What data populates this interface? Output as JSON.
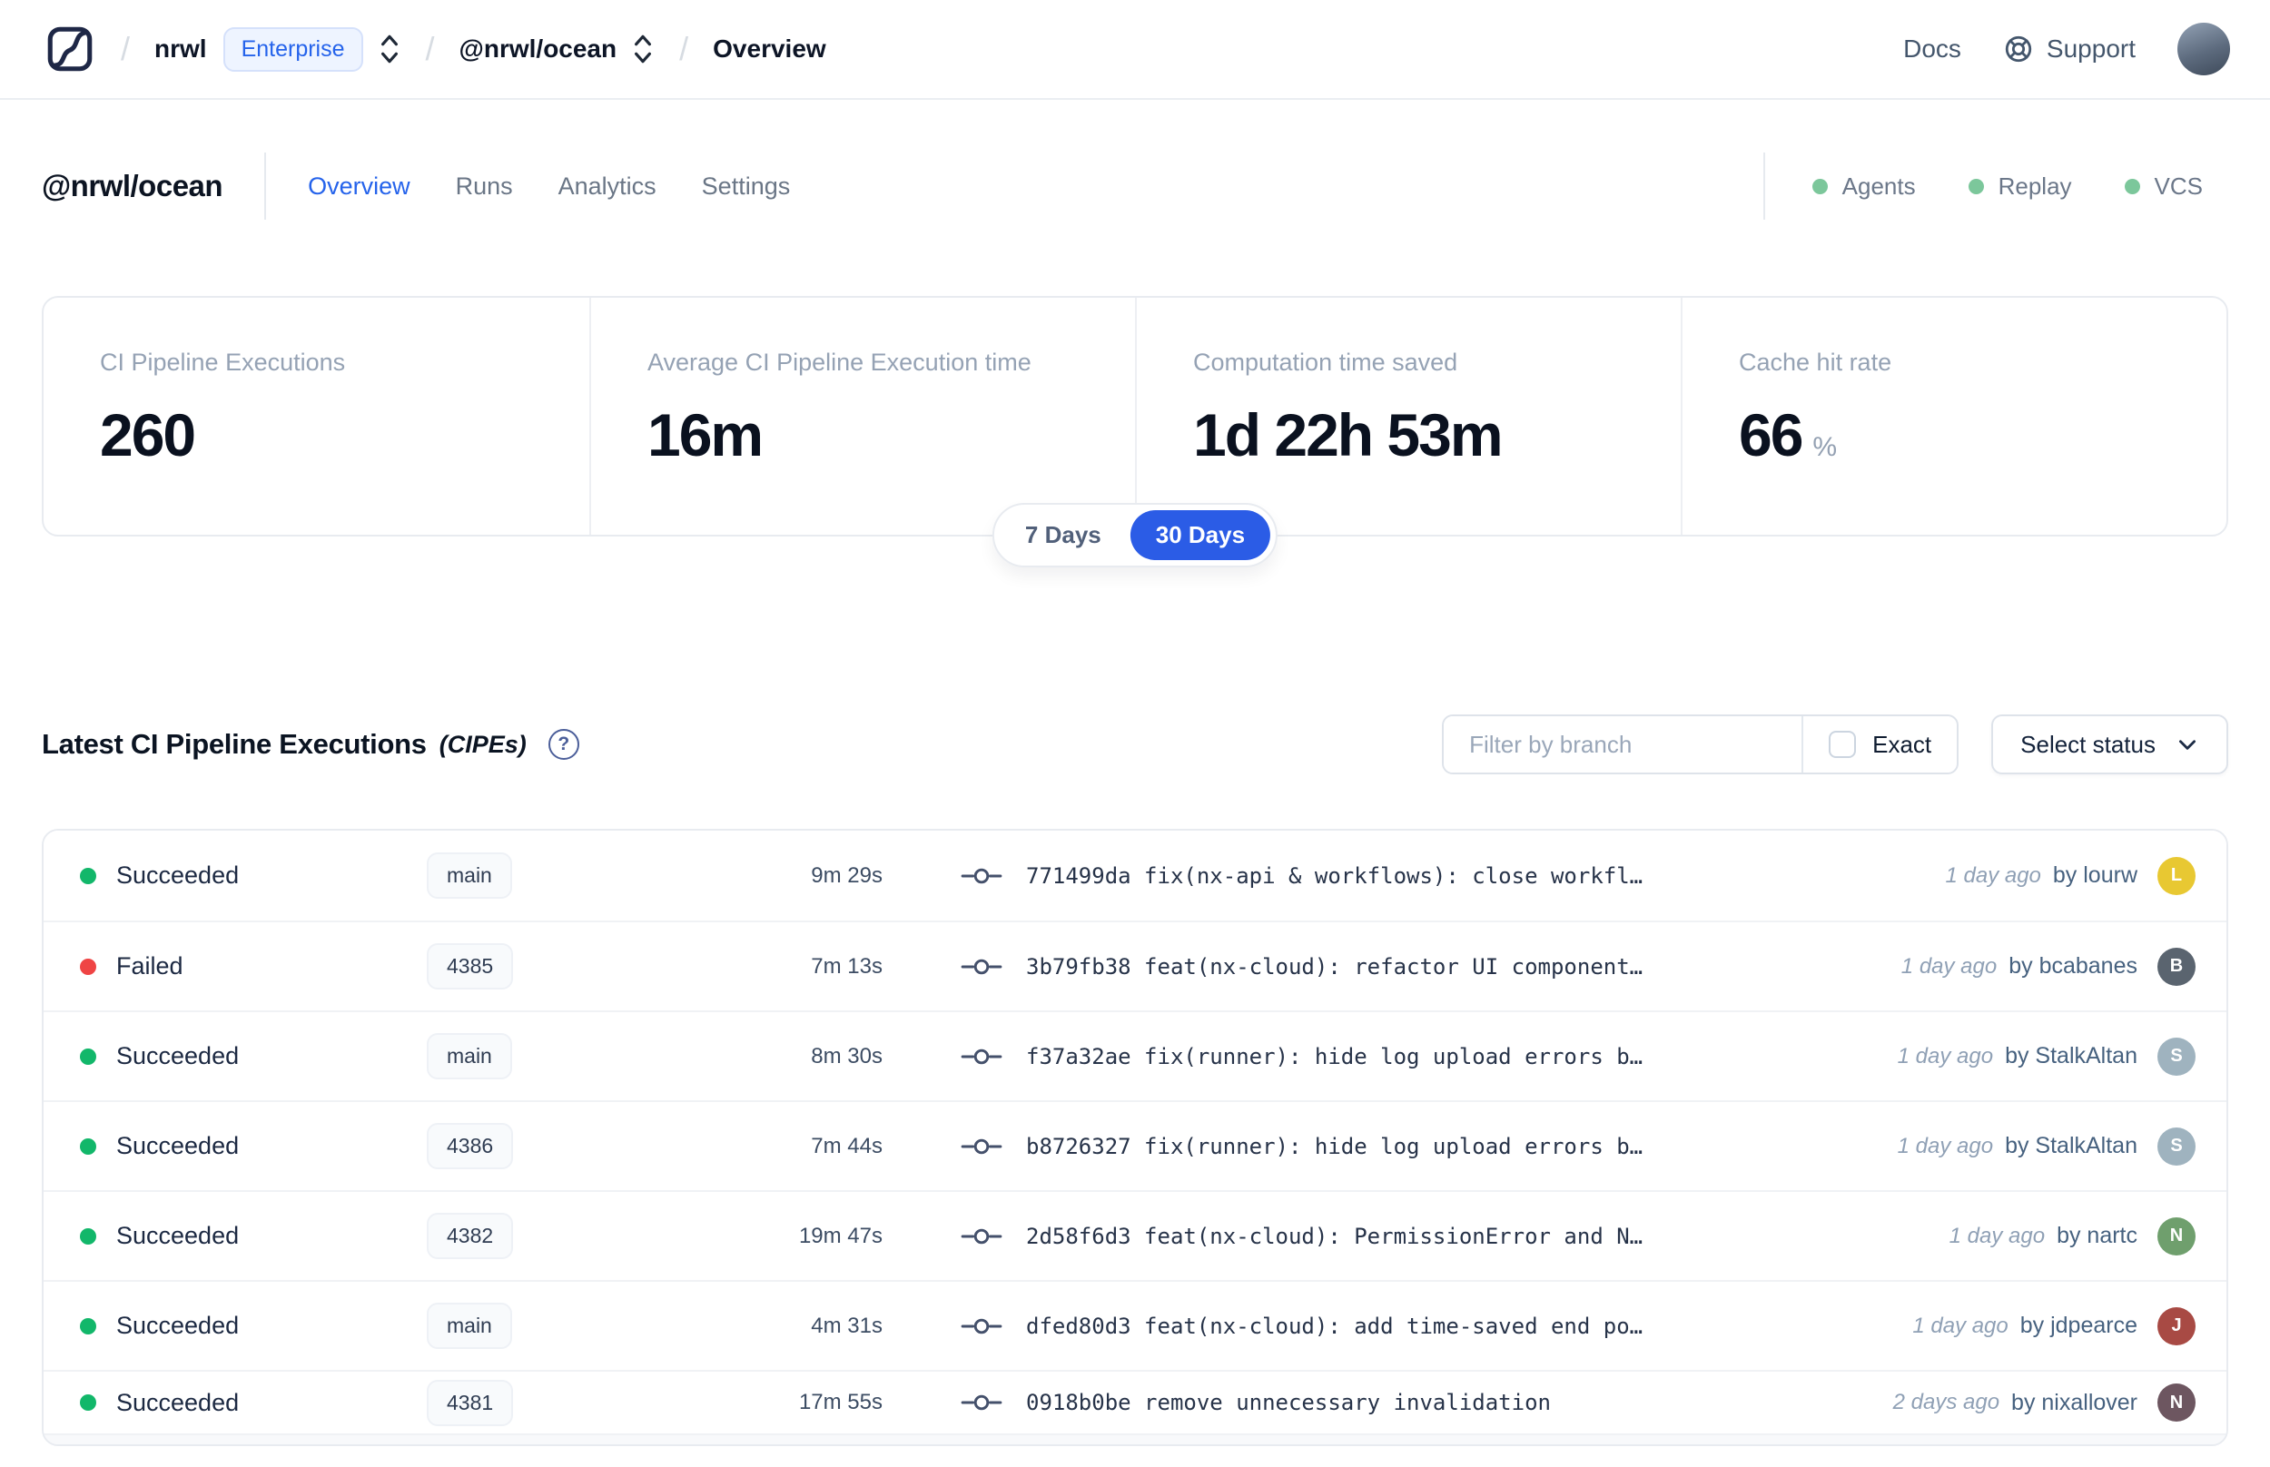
{
  "nav": {
    "breadcrumb": {
      "separator": "/",
      "org": "nrwl",
      "plan_badge": "Enterprise",
      "workspace": "@nrwl/ocean",
      "page": "Overview"
    },
    "docs_label": "Docs",
    "support_label": "Support"
  },
  "header": {
    "title": "@nrwl/ocean",
    "tabs": [
      {
        "label": "Overview",
        "active": true
      },
      {
        "label": "Runs",
        "active": false
      },
      {
        "label": "Analytics",
        "active": false
      },
      {
        "label": "Settings",
        "active": false
      }
    ],
    "indicators": [
      {
        "label": "Agents",
        "color": "#7cc79b"
      },
      {
        "label": "Replay",
        "color": "#7cc79b"
      },
      {
        "label": "VCS",
        "color": "#7cc79b"
      }
    ]
  },
  "stats": {
    "cards": [
      {
        "label": "CI Pipeline Executions",
        "value": "260",
        "unit": ""
      },
      {
        "label": "Average CI Pipeline Execution time",
        "value": "16m",
        "unit": ""
      },
      {
        "label": "Computation time saved",
        "value": "1d 22h 53m",
        "unit": ""
      },
      {
        "label": "Cache hit rate",
        "value": "66",
        "unit": "%"
      }
    ],
    "range_toggle": {
      "options": [
        {
          "label": "7 Days",
          "active": false
        },
        {
          "label": "30 Days",
          "active": true
        }
      ]
    }
  },
  "cipes": {
    "title": "Latest CI Pipeline Executions",
    "title_suffix": "(CIPEs)",
    "help_icon": "?",
    "filter": {
      "branch_placeholder": "Filter by branch",
      "exact_label": "Exact",
      "status_button_label": "Select status"
    },
    "rows": [
      {
        "status": "Succeeded",
        "status_color": "#12b76a",
        "branch": "main",
        "duration": "9m 29s",
        "commit": "771499da fix(nx-api & workflows): close workfl…",
        "time": "1 day ago",
        "author": "by lourw",
        "avatar_color": "#e8c832"
      },
      {
        "status": "Failed",
        "status_color": "#ef4444",
        "branch": "4385",
        "duration": "7m 13s",
        "commit": "3b79fb38 feat(nx-cloud): refactor UI component…",
        "time": "1 day ago",
        "author": "by bcabanes",
        "avatar_color": "#5a646f"
      },
      {
        "status": "Succeeded",
        "status_color": "#12b76a",
        "branch": "main",
        "duration": "8m 30s",
        "commit": "f37a32ae fix(runner): hide log upload errors b…",
        "time": "1 day ago",
        "author": "by StalkAltan",
        "avatar_color": "#9fb3bf"
      },
      {
        "status": "Succeeded",
        "status_color": "#12b76a",
        "branch": "4386",
        "duration": "7m 44s",
        "commit": "b8726327 fix(runner): hide log upload errors b…",
        "time": "1 day ago",
        "author": "by StalkAltan",
        "avatar_color": "#9fb3bf"
      },
      {
        "status": "Succeeded",
        "status_color": "#12b76a",
        "branch": "4382",
        "duration": "19m 47s",
        "commit": "2d58f6d3 feat(nx-cloud): PermissionError and N…",
        "time": "1 day ago",
        "author": "by nartc",
        "avatar_color": "#6f9f6d"
      },
      {
        "status": "Succeeded",
        "status_color": "#12b76a",
        "branch": "main",
        "duration": "4m 31s",
        "commit": "dfed80d3 feat(nx-cloud): add time-saved end po…",
        "time": "1 day ago",
        "author": "by jdpearce",
        "avatar_color": "#a84a44"
      },
      {
        "status": "Succeeded",
        "status_color": "#12b76a",
        "branch": "4381",
        "duration": "17m 55s",
        "commit": "0918b0be remove unnecessary invalidation",
        "time": "2 days ago",
        "author": "by nixallover",
        "avatar_color": "#6d5660"
      }
    ]
  },
  "colors": {
    "accent_blue": "#2b5ce6",
    "success_green": "#12b76a",
    "fail_red": "#ef4444"
  }
}
